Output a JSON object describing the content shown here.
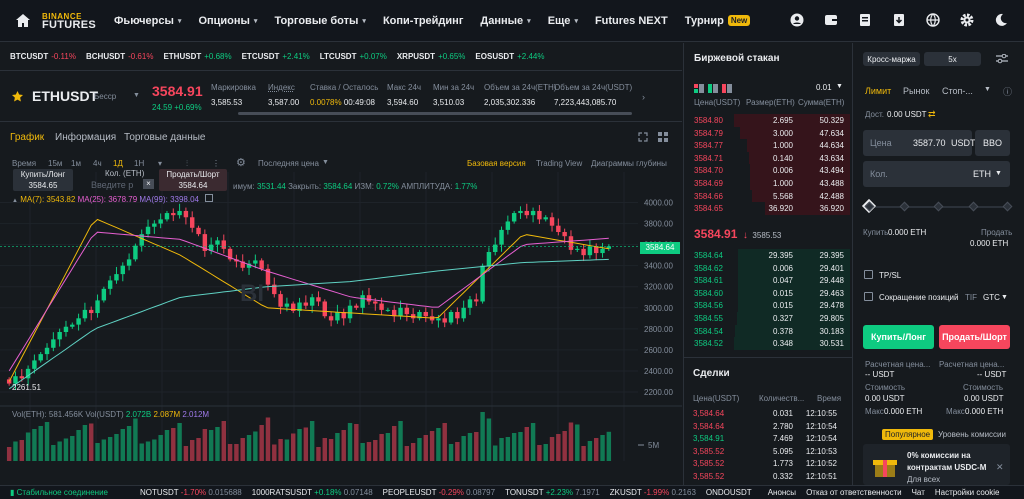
{
  "nav": {
    "logo_top": "BINANCE",
    "logo_bottom": "FUTURES",
    "items": [
      {
        "label": "Фьючерсы",
        "dd": true
      },
      {
        "label": "Опционы",
        "dd": true
      },
      {
        "label": "Торговые боты",
        "dd": true
      },
      {
        "label": "Копи-трейдинг",
        "dd": false
      },
      {
        "label": "Данные",
        "dd": true
      },
      {
        "label": "Еще",
        "dd": true
      },
      {
        "label": "Futures NEXT",
        "dd": false
      },
      {
        "label": "Турнир",
        "dd": false
      }
    ],
    "badge": "New"
  },
  "tickers": [
    {
      "s": "BTCUSDT",
      "c": "-0.11%",
      "d": "neg"
    },
    {
      "s": "BCHUSDT",
      "c": "-0.61%",
      "d": "neg"
    },
    {
      "s": "ETHUSDT",
      "c": "+0.68%",
      "d": "pos"
    },
    {
      "s": "ETCUSDT",
      "c": "+2.41%",
      "d": "pos"
    },
    {
      "s": "LTCUSDT",
      "c": "+0.07%",
      "d": "pos"
    },
    {
      "s": "XRPUSDT",
      "c": "+0.65%",
      "d": "pos"
    },
    {
      "s": "EOSUSDT",
      "c": "+2.44%",
      "d": "pos"
    }
  ],
  "symbol": {
    "name": "ETHUSDT",
    "type": "Бесср",
    "price": "3584.91",
    "change": "24.59 +0.69%"
  },
  "stats": [
    {
      "l": "Маркировка",
      "v": "3,585.53",
      "c": ""
    },
    {
      "l": "Индекс",
      "v": "3,587.00",
      "c": ""
    },
    {
      "l": "Ставка / Осталось",
      "v": "0.0078%",
      "v2": "00:49:08",
      "c": "acc"
    },
    {
      "l": "Макс 24ч",
      "v": "3,594.60",
      "c": ""
    },
    {
      "l": "Мин за 24ч",
      "v": "3,510.03",
      "c": ""
    },
    {
      "l": "Объем за 24ч(ETH)",
      "v": "2,035,302.336",
      "c": ""
    },
    {
      "l": "Объем за 24ч(USDT)",
      "v": "7,223,443,085.70",
      "c": ""
    }
  ],
  "tabs": {
    "chart": "График",
    "info": "Информация",
    "trade": "Торговые данные"
  },
  "timeframes": {
    "time": "Время",
    "m15": "15м",
    "m1": "1м",
    "h4": "4ч",
    "d1": "1Д",
    "w1": "1Н",
    "last": "Последняя цена",
    "basic": "Базовая версия",
    "tv": "Trading View",
    "depth": "Диаграммы глубины"
  },
  "chart_overlay": {
    "buy_label": "Купить/Лонг",
    "buy_price": "3584.65",
    "qty_label": "Кол. (ETH)",
    "qty_ph": "Введите р",
    "sell_label": "Продать/Шорт",
    "sell_price": "3584.64",
    "ohlc_head": "имум:",
    "ohlc_low": "3531.44",
    "close_label": "Закрыть:",
    "close_val": "3584.64",
    "chg_label": "ИЗМ:",
    "chg_val": "0.72%",
    "amp_label": "АМПЛИТУДА:",
    "amp_val": "1.77%",
    "ma7": "MA(7): 3543.82",
    "ma25": "MA(25): 3678.79",
    "ma99": "MA(99): 3398.04",
    "low_marker": "2261.51",
    "price_tag": "3584.64",
    "vol_label": "Vol(ETH): 581.456K",
    "vol_usdt": "Vol(USDT)",
    "vol_v1": "2.072B",
    "vol_v2": "2.087M",
    "vol_v3": "2.012M",
    "vol_tick": "5M",
    "watermark": "BI",
    "yticks": [
      "4000.00",
      "3800.00",
      "3600.00",
      "3400.00",
      "3200.00",
      "3000.00",
      "2800.00",
      "2600.00",
      "2400.00",
      "2200.00"
    ]
  },
  "chart_data": {
    "type": "candlestick",
    "x_label": "",
    "y_label": "",
    "ylim": [
      2200,
      4100
    ],
    "series": [
      {
        "name": "ETHUSDT",
        "close": [
          2280,
          2350,
          2330,
          2420,
          2500,
          2560,
          2620,
          2700,
          2770,
          2820,
          2840,
          2900,
          2980,
          2950,
          3070,
          3180,
          3260,
          3320,
          3400,
          3460,
          3590,
          3700,
          3770,
          3800,
          3840,
          3900,
          3880,
          3920,
          3860,
          3760,
          3700,
          3540,
          3600,
          3640,
          3560,
          3460,
          3440,
          3380,
          3420,
          3450,
          3370,
          3220,
          3130,
          3010,
          3040,
          2970,
          3050,
          3020,
          3100,
          3060,
          2920,
          2880,
          2960,
          2900,
          3020,
          3000,
          3120,
          3060,
          3040,
          2980,
          2980,
          2920,
          3000,
          2940,
          2900,
          2960,
          2920,
          2880,
          2900,
          2860,
          2960,
          2900,
          3000,
          3080,
          3060,
          3400,
          3530,
          3600,
          3740,
          3820,
          3900,
          3920,
          3880,
          3920,
          3840,
          3860,
          3780,
          3720,
          3680,
          3550,
          3560,
          3500,
          3580,
          3520,
          3560,
          3584
        ]
      },
      {
        "name": "MA(7)",
        "values": [
          2300,
          3850,
          3500,
          3000,
          2950,
          2900,
          3700,
          3560
        ]
      },
      {
        "name": "MA(25)",
        "values": [
          2400,
          3720,
          3650,
          3350,
          3100,
          3000,
          3600,
          3660
        ]
      },
      {
        "name": "MA(99)",
        "values": [
          2230,
          2800,
          3100,
          3200,
          3250,
          3350,
          3430,
          3460
        ]
      }
    ]
  },
  "orderbook": {
    "title": "Биржевой стакан",
    "step": "0.01",
    "h_price": "Цена(USDT)",
    "h_size": "Размер(ETH)",
    "h_sum": "Сумма(ETH)",
    "asks": [
      [
        "3584.80",
        "2.695",
        "50.329"
      ],
      [
        "3584.79",
        "3.000",
        "47.634"
      ],
      [
        "3584.77",
        "1.000",
        "44.634"
      ],
      [
        "3584.71",
        "0.140",
        "43.634"
      ],
      [
        "3584.70",
        "0.006",
        "43.494"
      ],
      [
        "3584.69",
        "1.000",
        "43.488"
      ],
      [
        "3584.66",
        "5.568",
        "42.488"
      ],
      [
        "3584.65",
        "36.920",
        "36.920"
      ]
    ],
    "mid_price": "3584.91",
    "mark": "3585.53",
    "bids": [
      [
        "3584.64",
        "29.395",
        "29.395"
      ],
      [
        "3584.62",
        "0.006",
        "29.401"
      ],
      [
        "3584.61",
        "0.047",
        "29.448"
      ],
      [
        "3584.60",
        "0.015",
        "29.463"
      ],
      [
        "3584.56",
        "0.015",
        "29.478"
      ],
      [
        "3584.55",
        "0.327",
        "29.805"
      ],
      [
        "3584.54",
        "0.378",
        "30.183"
      ],
      [
        "3584.52",
        "0.348",
        "30.531"
      ]
    ]
  },
  "trades": {
    "title": "Сделки",
    "h_price": "Цена(USDT)",
    "h_qty": "Количеств...",
    "h_time": "Время",
    "rows": [
      [
        "3,584.64",
        "0.031",
        "12:10:55",
        "neg"
      ],
      [
        "3,584.64",
        "2.780",
        "12:10:54",
        "neg"
      ],
      [
        "3,584.91",
        "7.469",
        "12:10:54",
        "pos"
      ],
      [
        "3,585.52",
        "5.095",
        "12:10:53",
        "neg"
      ],
      [
        "3,585.52",
        "1.773",
        "12:10:52",
        "neg"
      ],
      [
        "3,585.52",
        "0.332",
        "12:10:51",
        "neg"
      ]
    ]
  },
  "order": {
    "margin": "Кросс-маржа",
    "lev": "5x",
    "limit": "Лимит",
    "market": "Рынок",
    "stop": "Стоп-...",
    "avail_label": "Дост.",
    "avail_val": "0.00 USDT",
    "price_label": "Цена",
    "price_val": "3587.70",
    "price_unit": "USDT",
    "bbo": "BBO",
    "qty_label": "Кол.",
    "qty_unit": "ETH",
    "buy_label": "Купить",
    "buy_val": "0.000 ETH",
    "sell_label": "Продать",
    "sell_val": "0.000 ETH",
    "tpsl": "TP/SL",
    "reduce": "Сокращение позиций",
    "tif": "TIF",
    "tif_val": "GTC",
    "buy_btn": "Купить/Лонг",
    "sell_btn": "Продать/Шорт",
    "liq_label": "Расчетная цена...",
    "liq_val": "-- USDT",
    "liq_label2": "Расчетная цена...",
    "liq_val2": "-- USDT",
    "cost_label": "Стоимость",
    "cost_val": "0.00 USDT",
    "cost_label2": "Стоимость",
    "cost_val2": "0.00 USDT",
    "max_label": "Макс",
    "max_val": "0.000 ETH",
    "max_label2": "Макс",
    "max_val2": "0.000 ETH",
    "popular": "Популярное",
    "fee": "Уровень комиссии",
    "promo1": "0% комиссии на",
    "promo2": "контрактам USDC-M",
    "promo3": "Для всех"
  },
  "status": {
    "conn": "Стабильное соединение",
    "items": [
      {
        "s": "NOTUSDT",
        "c": "-1.70%",
        "p": "0.015688",
        "d": "neg"
      },
      {
        "s": "1000RATSUSDT",
        "c": "+0.18%",
        "p": "0.07148",
        "d": "pos"
      },
      {
        "s": "PEOPLEUSDT",
        "c": "-0.29%",
        "p": "0.08797",
        "d": "neg"
      },
      {
        "s": "TONUSDT",
        "c": "+2.23%",
        "p": "7.1971",
        "d": "pos"
      },
      {
        "s": "ZKUSDT",
        "c": "-1.99%",
        "p": "0.2163",
        "d": "neg"
      },
      {
        "s": "ONDOUSDT",
        "c": "",
        "p": "",
        "d": "pos"
      }
    ],
    "links": [
      "Анонсы",
      "Отказ от ответственности",
      "Чат",
      "Настройки cookie"
    ]
  }
}
